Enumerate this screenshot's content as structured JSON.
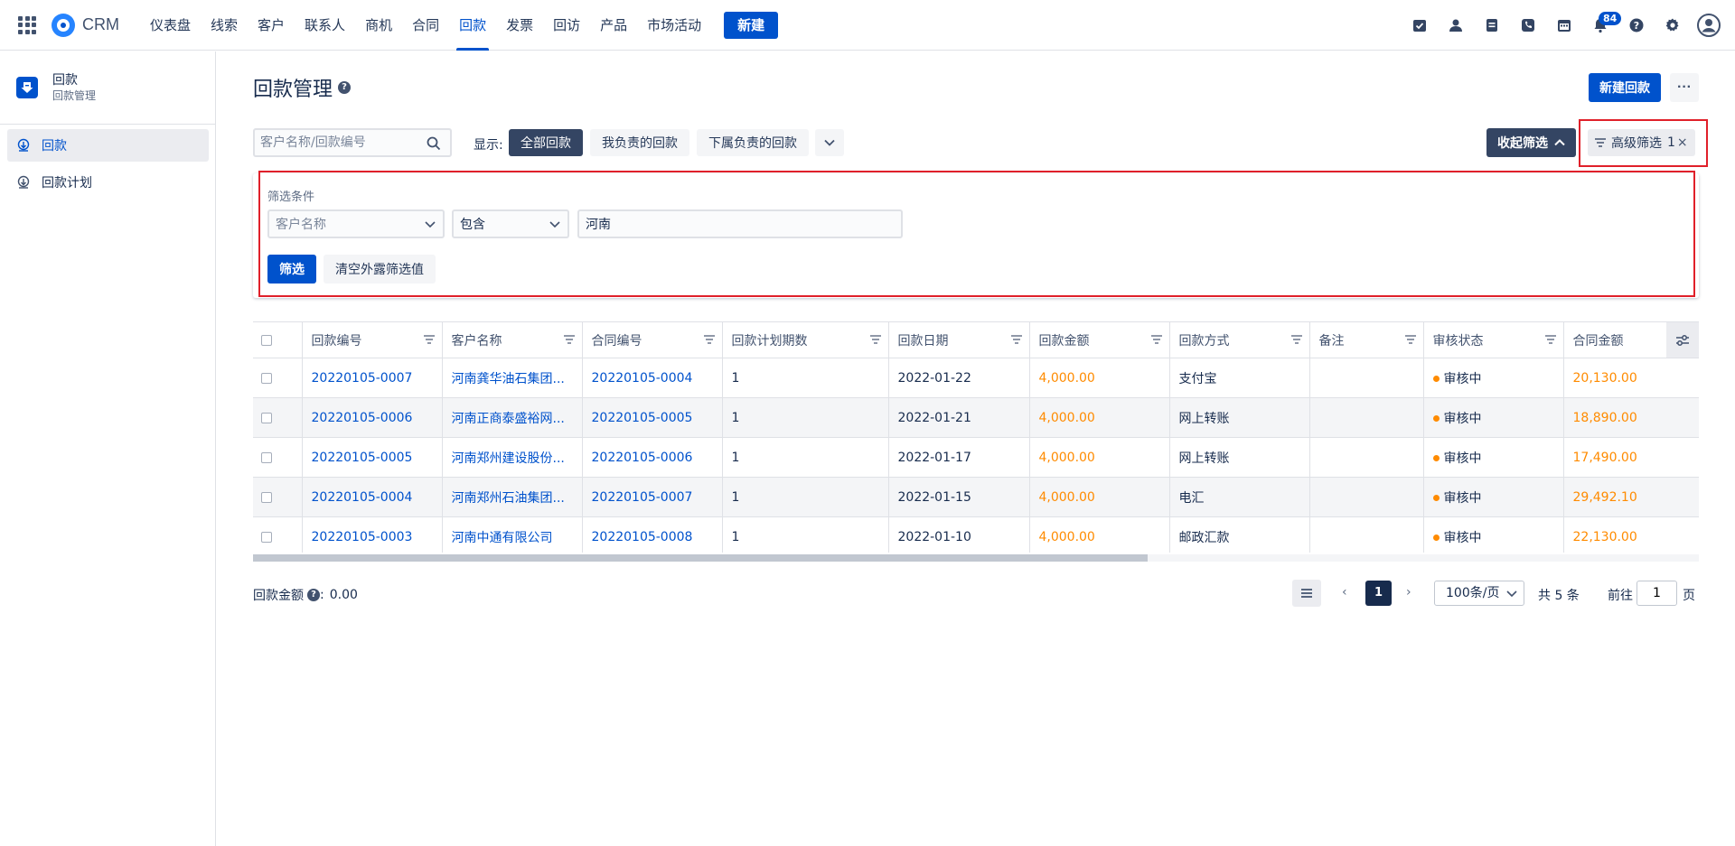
{
  "app": {
    "brand": "CRM"
  },
  "nav": {
    "items": [
      {
        "label": "仪表盘",
        "active": false
      },
      {
        "label": "线索",
        "active": false
      },
      {
        "label": "客户",
        "active": false
      },
      {
        "label": "联系人",
        "active": false
      },
      {
        "label": "商机",
        "active": false
      },
      {
        "label": "合同",
        "active": false
      },
      {
        "label": "回款",
        "active": true
      },
      {
        "label": "发票",
        "active": false
      },
      {
        "label": "回访",
        "active": false
      },
      {
        "label": "产品",
        "active": false
      },
      {
        "label": "市场活动",
        "active": false
      }
    ],
    "new_label": "新建",
    "notification_count": "84",
    "icons": [
      "task-icon",
      "contact-icon",
      "note-icon",
      "phone-icon",
      "calendar-icon",
      "bell-icon",
      "help-icon",
      "gear-icon",
      "avatar-icon"
    ],
    "accent": "#0052cc"
  },
  "sidebar": {
    "title": "回款",
    "subtitle": "回款管理",
    "items": [
      {
        "label": "回款",
        "active": true,
        "icon": "payment-icon"
      },
      {
        "label": "回款计划",
        "active": false,
        "icon": "payment-plan-icon"
      }
    ]
  },
  "page": {
    "title": "回款管理",
    "help": "?",
    "new_button": "新建回款",
    "more_button": "···"
  },
  "toolbar": {
    "search_placeholder": "客户名称/回款编号",
    "show_label": "显示:",
    "segments": [
      "全部回款",
      "我负责的回款",
      "下属负责的回款"
    ],
    "active_segment": 0,
    "collapse_filter": "收起筛选",
    "advanced_filter": "高级筛选",
    "advanced_filter_count": "1",
    "advanced_filter_clear": "×"
  },
  "filter": {
    "title": "筛选条件",
    "field_placeholder": "客户名称",
    "operator": "包含",
    "value": "河南",
    "apply_button": "筛选",
    "clear_button": "清空外露筛选值"
  },
  "table": {
    "columns": [
      "回款编号",
      "客户名称",
      "合同编号",
      "回款计划期数",
      "回款日期",
      "回款金额",
      "回款方式",
      "备注",
      "审核状态",
      "合同金额"
    ],
    "rows": [
      {
        "no": "20220105-0007",
        "customer": "河南龚华油石集团...",
        "contract": "20220105-0004",
        "period": "1",
        "date": "2022-01-22",
        "amount": "4,000.00",
        "method": "支付宝",
        "remark": "",
        "status": "审核中",
        "contract_amount": "20,130.00"
      },
      {
        "no": "20220105-0006",
        "customer": "河南正商泰盛裕网...",
        "contract": "20220105-0005",
        "period": "1",
        "date": "2022-01-21",
        "amount": "4,000.00",
        "method": "网上转账",
        "remark": "",
        "status": "审核中",
        "contract_amount": "18,890.00"
      },
      {
        "no": "20220105-0005",
        "customer": "河南郑州建设股份...",
        "contract": "20220105-0006",
        "period": "1",
        "date": "2022-01-17",
        "amount": "4,000.00",
        "method": "网上转账",
        "remark": "",
        "status": "审核中",
        "contract_amount": "17,490.00"
      },
      {
        "no": "20220105-0004",
        "customer": "河南郑州石油集团...",
        "contract": "20220105-0007",
        "period": "1",
        "date": "2022-01-15",
        "amount": "4,000.00",
        "method": "电汇",
        "remark": "",
        "status": "审核中",
        "contract_amount": "29,492.10"
      },
      {
        "no": "20220105-0003",
        "customer": "河南中通有限公司",
        "contract": "20220105-0008",
        "period": "1",
        "date": "2022-01-10",
        "amount": "4,000.00",
        "method": "邮政汇款",
        "remark": "",
        "status": "审核中",
        "contract_amount": "22,130.00"
      }
    ],
    "status_color": "#ff8b00",
    "amount_color": "#ff8b00"
  },
  "footer": {
    "total_label": "回款金额",
    "total_help": "?",
    "total_sep": ":",
    "total_value": "0.00",
    "current_page": "1",
    "page_size": "100条/页",
    "total_count": "共 5 条",
    "goto_label": "前往",
    "goto_value": "1",
    "page_unit": "页",
    "prev": "‹",
    "next": "›"
  }
}
